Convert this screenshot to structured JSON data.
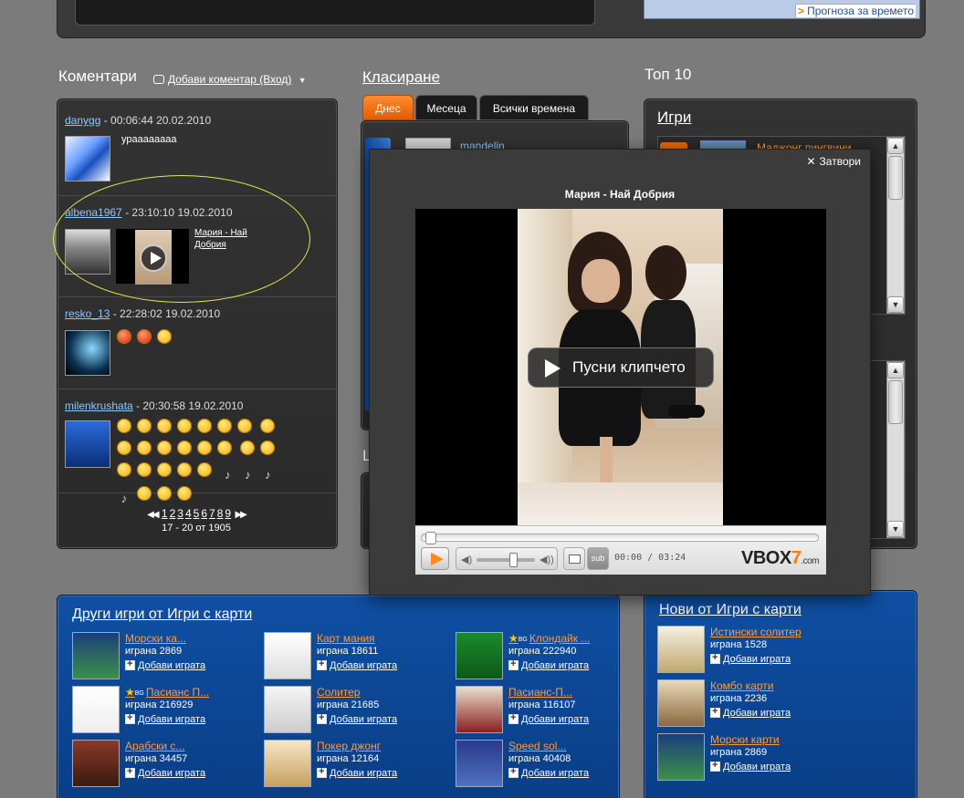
{
  "top": {
    "weather_link": "Прогноза за времето"
  },
  "comments": {
    "title": "Коментари",
    "add_link": "Добави коментар (Вход)",
    "items": [
      {
        "user": "danygg",
        "meta": " - 00:06:44 20.02.2010",
        "text": "урааааааaa"
      },
      {
        "user": "albena1967",
        "meta": " - 23:10:10 19.02.2010",
        "video_title": "Мария - Най Добрия"
      },
      {
        "user": "resko_13",
        "meta": " - 22:28:02 19.02.2010"
      },
      {
        "user": "milenkrushata",
        "meta": " - 20:30:58 19.02.2010"
      }
    ],
    "pager": {
      "pages": [
        "1",
        "2",
        "3",
        "4",
        "5",
        "6",
        "7",
        "8",
        "9"
      ],
      "range": "17 - 20 от 1905"
    }
  },
  "ranking": {
    "title": "Класиране",
    "tabs": [
      "Днес",
      "Месеца",
      "Всички времена"
    ],
    "first_user": "mandelin",
    "l_letter": "L"
  },
  "top10": {
    "title": "Топ 10",
    "games_title": "Игри",
    "first_game": "Маджонг пингвини"
  },
  "modal": {
    "close_label": "Затвори",
    "title": "Мария - Най Добрия",
    "play_label": "Пусни клипчето",
    "time": "00:00 / 03:24",
    "sub_label": "sub",
    "brand_main": "VBOX",
    "brand_seven": "7",
    "brand_suffix": ".com"
  },
  "other_games": {
    "title": "Други игри от Игри с карти",
    "add_label": "Добави играта",
    "bg_label": "BG",
    "items": [
      {
        "name": "Морски ка...",
        "played": "играна 2869"
      },
      {
        "name": "Карт мания",
        "played": "играна 18611"
      },
      {
        "name": "Клондайк ...",
        "played": "играна 222940",
        "bg": true
      },
      {
        "name": "Пасианс П...",
        "played": "играна 216929",
        "bg": true
      },
      {
        "name": "Солитер",
        "played": "играна 21685"
      },
      {
        "name": "Пасианс-П...",
        "played": "играна 116107"
      },
      {
        "name": "Арабски с...",
        "played": "играна 34457"
      },
      {
        "name": "Покер джонг",
        "played": "играна 12164"
      },
      {
        "name": "Speed sol...",
        "played": "играна 40408"
      }
    ]
  },
  "new_games": {
    "title": "Нови от Игри с карти",
    "add_label": "Добави играта",
    "items": [
      {
        "name": "Истински солитер",
        "played": "играна 1528"
      },
      {
        "name": "Комбо карти",
        "played": "играна 2236"
      },
      {
        "name": "Морски карти",
        "played": "играна 2869"
      }
    ]
  },
  "colors": {
    "accent_orange": "#ff8c30",
    "link_blue": "#8fc8ff",
    "panel_blue": "#0f4fa3"
  }
}
